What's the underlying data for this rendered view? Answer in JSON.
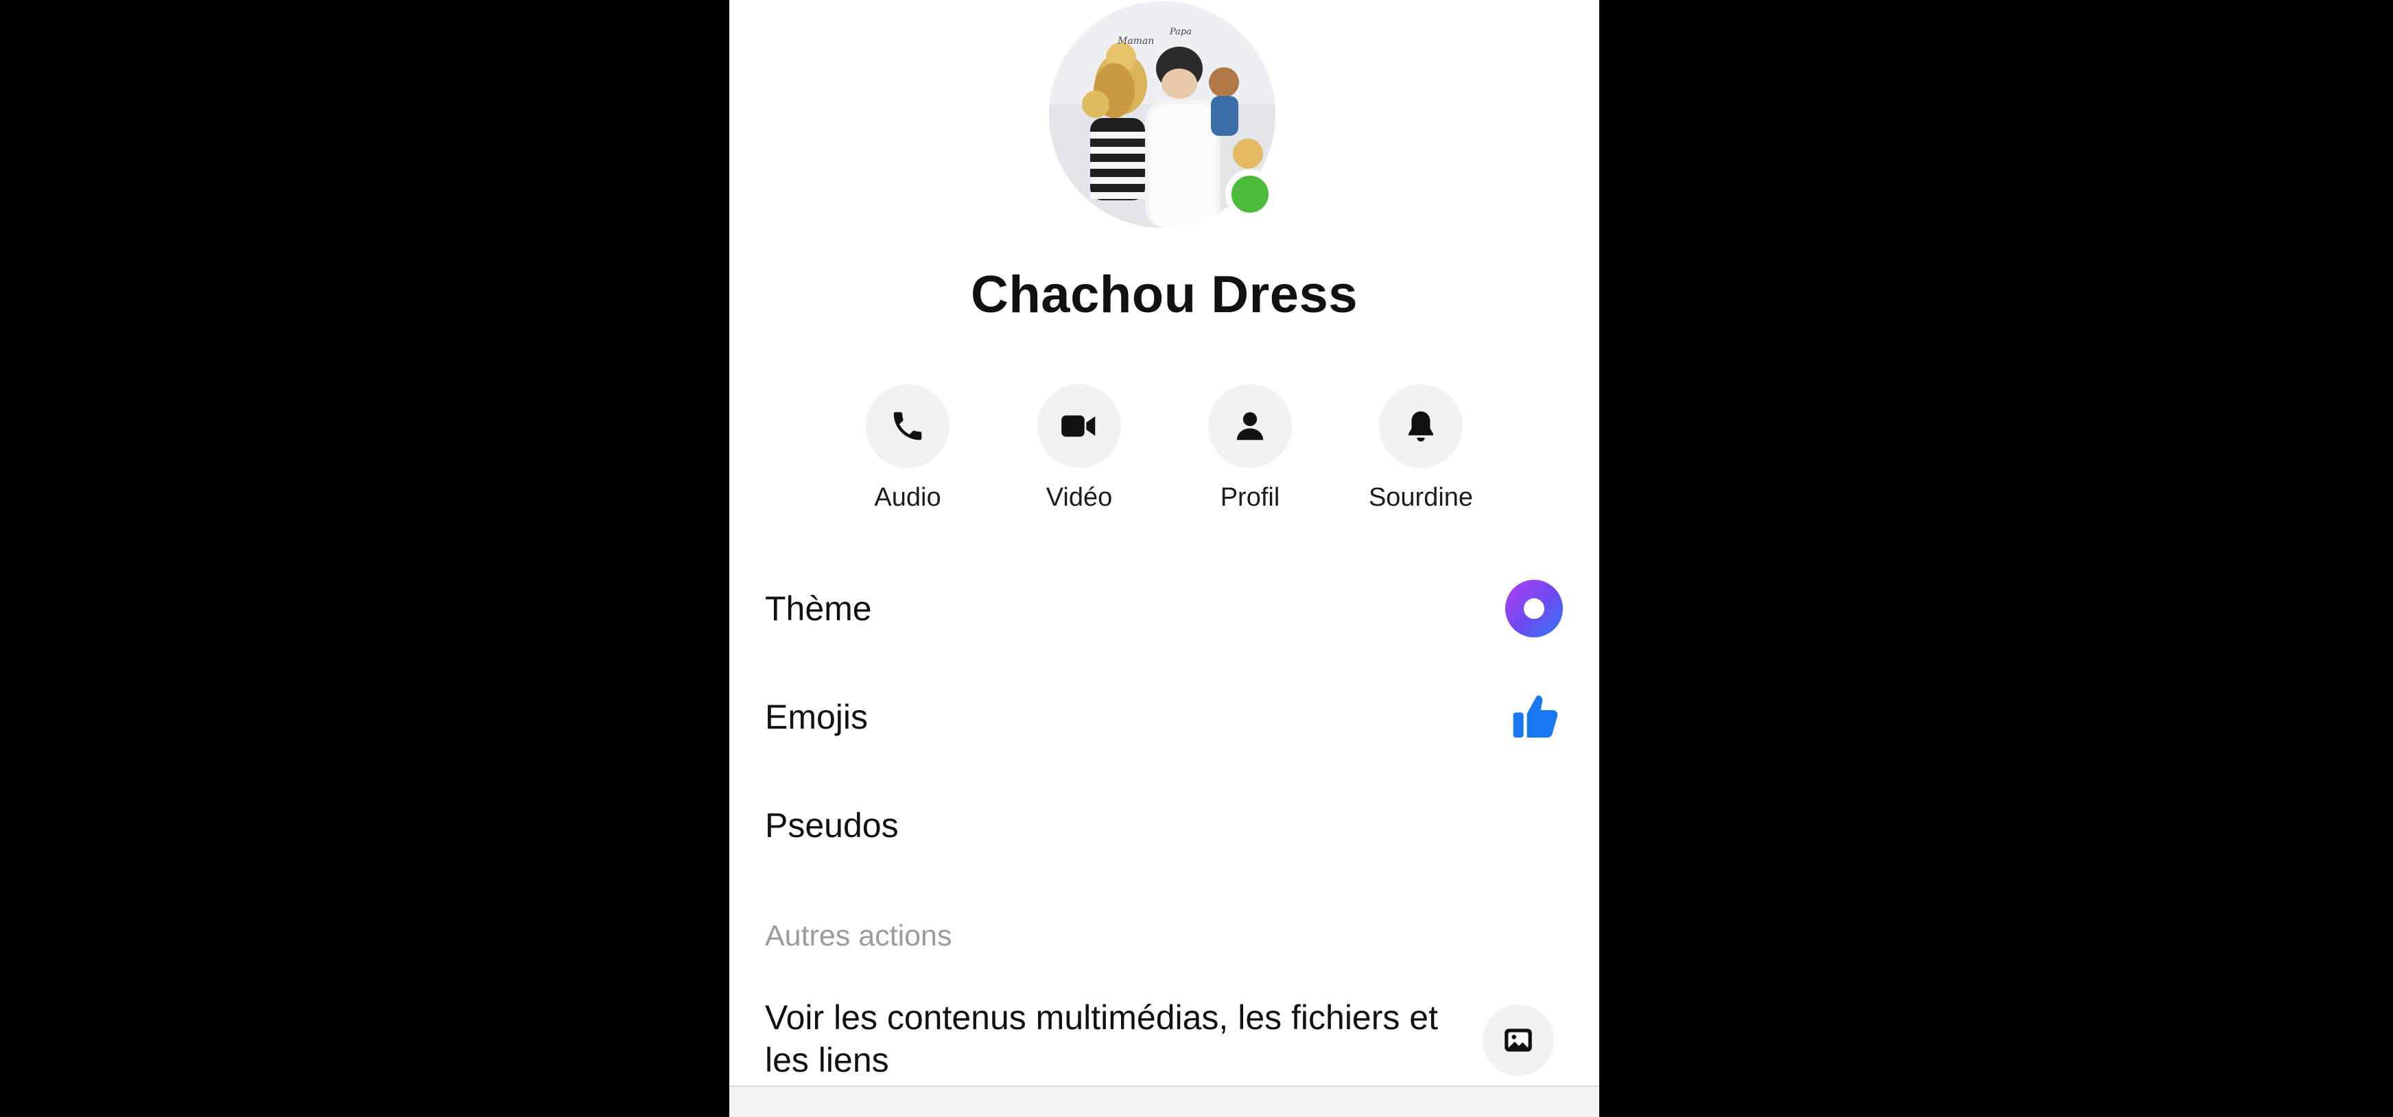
{
  "contact": {
    "name": "Chachou Dress",
    "online": true,
    "avatar_annotations": [
      "Papa",
      "Maman"
    ]
  },
  "actions": [
    {
      "label": "Audio",
      "icon": "phone-icon"
    },
    {
      "label": "Vidéo",
      "icon": "video-camera-icon"
    },
    {
      "label": "Profil",
      "icon": "person-icon"
    },
    {
      "label": "Sourdine",
      "icon": "bell-icon"
    }
  ],
  "settings": [
    {
      "label": "Thème",
      "icon": "theme-ring-icon"
    },
    {
      "label": "Emojis",
      "icon": "thumbs-up-icon"
    },
    {
      "label": "Pseudos"
    }
  ],
  "more_actions": {
    "title": "Autres actions",
    "media_label": "Voir les contenus multimédias, les fichiers et les liens",
    "media_icon": "image-icon"
  },
  "colors": {
    "online": "#4cbb3c",
    "theme_gradient_start": "#7b3ff2",
    "theme_gradient_end": "#2f7cf6",
    "thumb": "#1877f2",
    "background": "#ffffff",
    "letterbox": "#000000"
  }
}
